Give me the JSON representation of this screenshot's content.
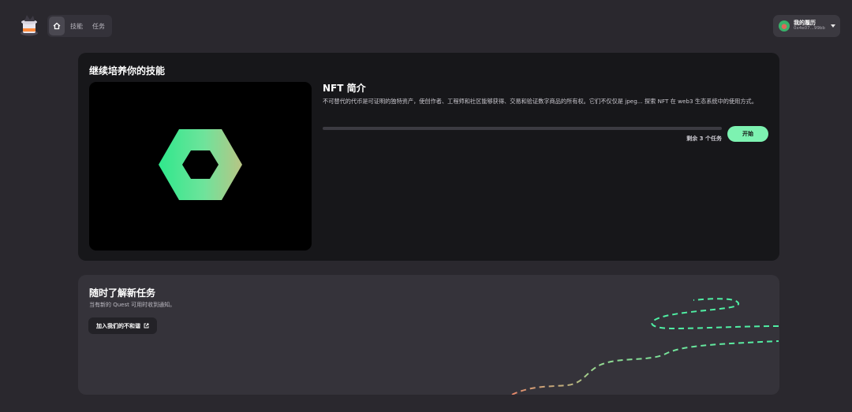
{
  "nav": {
    "home_icon": "home-icon",
    "tabs": [
      {
        "label": "技能"
      },
      {
        "label": "任务"
      }
    ]
  },
  "profile": {
    "name": "我的履历",
    "address": "0x4e07...99bb"
  },
  "continue_section": {
    "title": "继续培养你的技能",
    "course": {
      "title": "NFT 简介",
      "description": "不可替代的代币是可证明的独特资产，使创作者、工程师和社区能够获得、交易和验证数字商品的所有权。它们不仅仅是 jpeg... 探索 NFT 在 web3 生态系统中的使用方式。",
      "progress": 0,
      "remaining": "剩余 3 个任务",
      "start_label": "开始"
    }
  },
  "news_section": {
    "title": "随时了解新任务",
    "subtitle": "当有新的 Quest 可用时收到通知。",
    "button_label": "加入我们的不和谐"
  },
  "colors": {
    "accent": "#7df2b1",
    "background": "#2a282e",
    "card_dark": "#17171a",
    "card_light": "#35333a"
  }
}
